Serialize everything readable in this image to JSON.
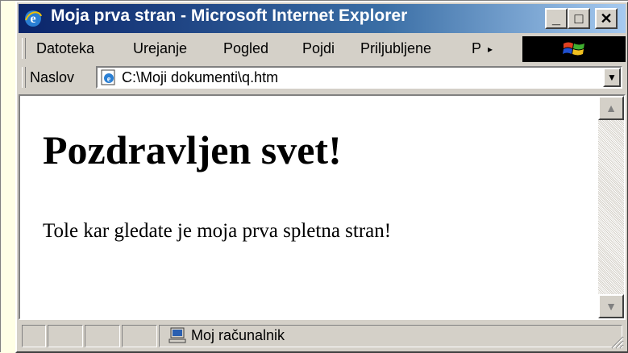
{
  "window": {
    "title": "Moja prva stran - Microsoft Internet Explorer",
    "controls": {
      "minimize": "_",
      "maximize": "□",
      "close": "✕"
    },
    "title_gradient": [
      "#0a246a",
      "#a6caf0"
    ]
  },
  "menubar": {
    "items": [
      {
        "label": "Datoteka"
      },
      {
        "label": "Urejanje"
      },
      {
        "label": "Pogled"
      },
      {
        "label": "Pojdi"
      },
      {
        "label": "Priljubljene"
      },
      {
        "label": "P"
      }
    ],
    "overflow_glyph": "▸"
  },
  "addressbar": {
    "label": "Naslov",
    "value": "C:\\Moji dokumenti\\q.htm",
    "dropdown_glyph": "▼"
  },
  "content": {
    "heading": "Pozdravljen svet!",
    "paragraph": "Tole kar gledate je moja prva spletna stran!"
  },
  "scrollbar": {
    "up_glyph": "▲",
    "down_glyph": "▼"
  },
  "statusbar": {
    "zone": "Moj računalnik"
  },
  "icons": {
    "title": "ie-logo-icon",
    "address": "ie-page-icon",
    "status": "computer-icon",
    "throbber": "windows-logo-icon"
  }
}
